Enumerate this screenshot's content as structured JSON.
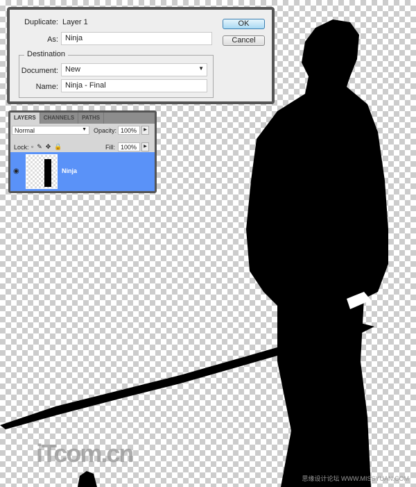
{
  "dialog": {
    "duplicate_label": "Duplicate:",
    "duplicate_value": "Layer 1",
    "as_label": "As:",
    "as_value": "Ninja",
    "destination_title": "Destination",
    "document_label": "Document:",
    "document_value": "New",
    "name_label": "Name:",
    "name_value": "Ninja - Final",
    "ok": "OK",
    "cancel": "Cancel"
  },
  "layers": {
    "tabs": [
      "LAYERS",
      "CHANNELS",
      "PATHS"
    ],
    "blend_mode": "Normal",
    "opacity_label": "Opacity:",
    "opacity": "100%",
    "lock_label": "Lock:",
    "fill_label": "Fill:",
    "fill": "100%",
    "layer_name": "Ninja"
  },
  "watermark": {
    "logo": "iTcom.cn",
    "site": "思缘设计论坛 WWW.MISSYUAN.COM"
  }
}
